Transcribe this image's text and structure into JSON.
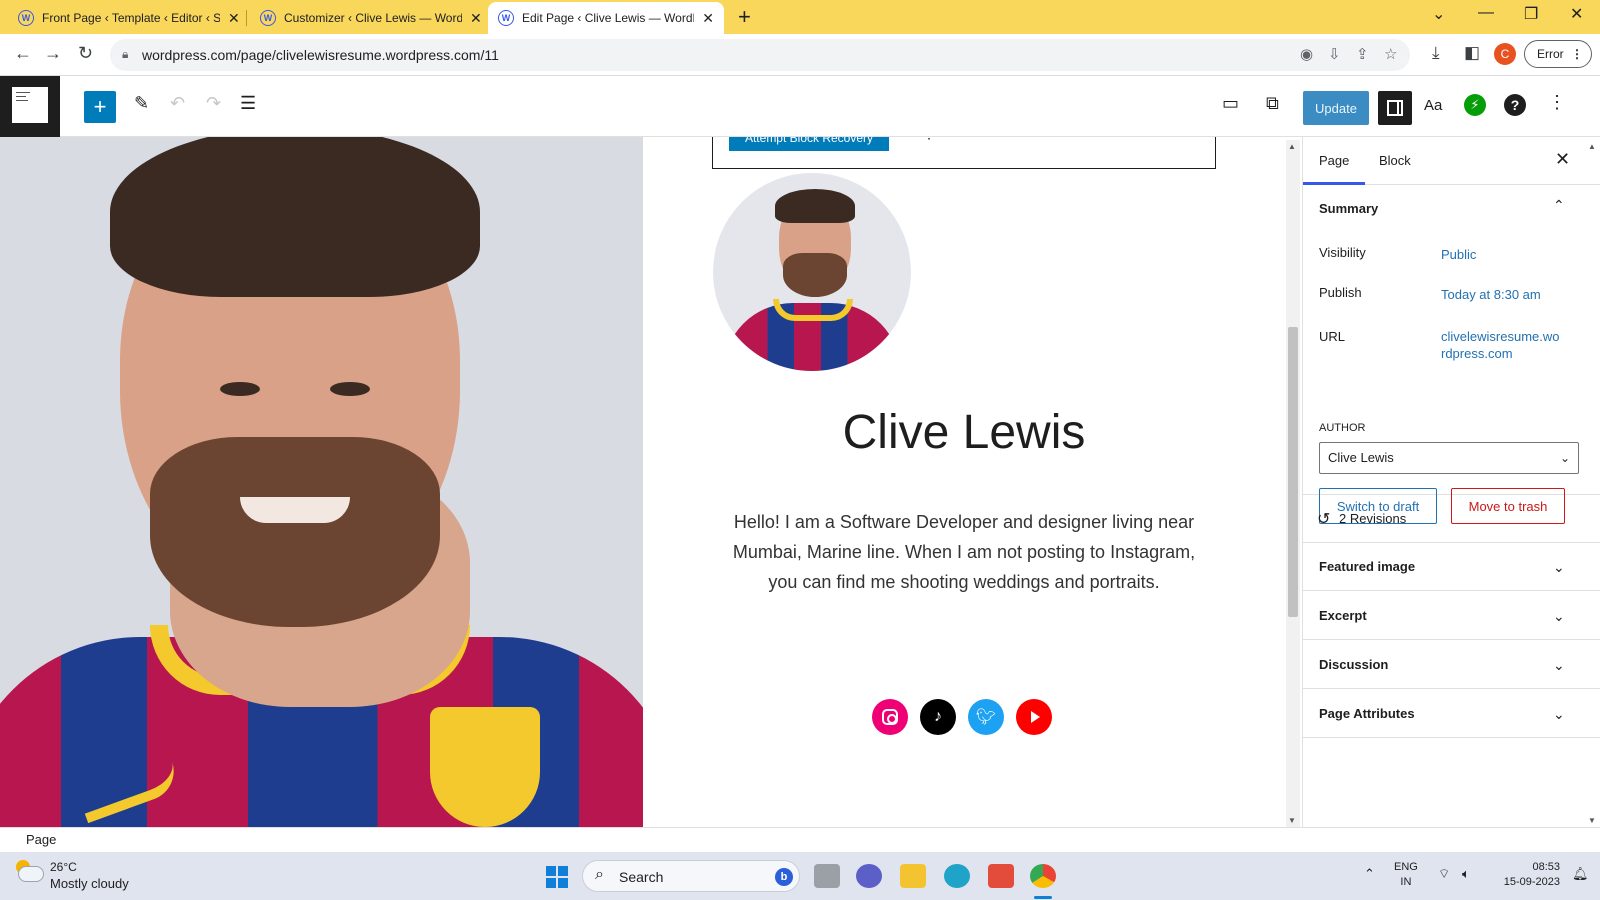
{
  "browser": {
    "tabs": [
      {
        "title": "Front Page ‹ Template ‹ Editor ‹ S",
        "active": false
      },
      {
        "title": "Customizer ‹ Clive Lewis — Word",
        "active": false
      },
      {
        "title": "Edit Page ‹ Clive Lewis — WordPr",
        "active": true
      }
    ],
    "url": "wordpress.com/page/clivelewisresume.wordpress.com/11",
    "profile_initial": "C",
    "error_label": "Error"
  },
  "editor": {
    "update_label": "Update",
    "styles_label": "Aa",
    "help_label": "?"
  },
  "canvas": {
    "recovery_button": "Attempt Block Recovery",
    "recovery_more": "⋮",
    "site_title": "Clive Lewis",
    "bio": "Hello! I am a Software Developer and designer living near Mumbai, Marine line. When I am not posting to Instagram, you can find me shooting weddings and portraits.",
    "social_icons": [
      "instagram-icon",
      "tiktok-icon",
      "twitter-icon",
      "youtube-icon"
    ]
  },
  "sidebar": {
    "tabs": [
      "Page",
      "Block"
    ],
    "summary": {
      "title": "Summary",
      "visibility_label": "Visibility",
      "visibility_value": "Public",
      "publish_label": "Publish",
      "publish_value": "Today at 8:30 am",
      "url_label": "URL",
      "url_value": "clivelewisresume.wordpress.com",
      "author_label": "AUTHOR",
      "author_value": "Clive Lewis",
      "switch_draft": "Switch to draft",
      "move_trash": "Move to trash"
    },
    "revisions": "2 Revisions",
    "panels": [
      "Featured image",
      "Excerpt",
      "Discussion",
      "Page Attributes"
    ]
  },
  "footer": {
    "breadcrumb": "Page"
  },
  "taskbar": {
    "temperature": "26°C",
    "weather": "Mostly cloudy",
    "search_label": "Search",
    "lang_line1": "ENG",
    "lang_line2": "IN",
    "time": "08:53",
    "date": "15-09-2023",
    "chrome_badge": "C"
  },
  "colors": {
    "tabstrip": "#f8d75a",
    "wp_blue": "#007cba",
    "update_button": "#3a8cc3",
    "link_blue": "#2271b1",
    "trash_red": "#cc1818"
  }
}
